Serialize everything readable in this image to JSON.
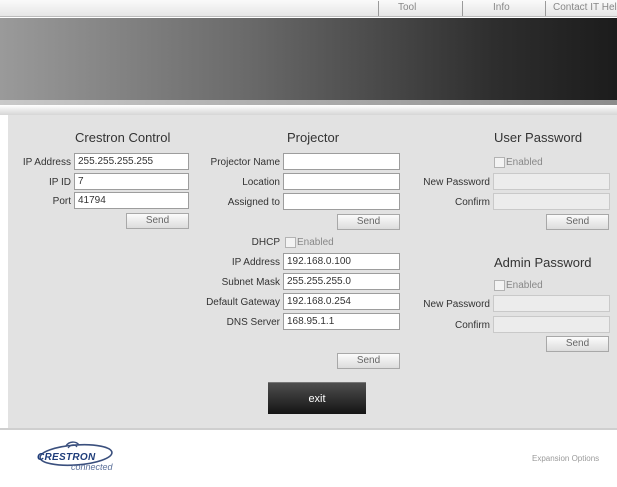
{
  "topnav": {
    "tool": "Tool",
    "info": "Info",
    "contact": "Contact IT Help"
  },
  "crestron": {
    "title": "Crestron Control",
    "ip_label": "IP Address",
    "ip_value": "255.255.255.255",
    "ipid_label": "IP ID",
    "ipid_value": "7",
    "port_label": "Port",
    "port_value": "41794",
    "send": "Send"
  },
  "projector": {
    "title": "Projector",
    "name_label": "Projector Name",
    "name_value": "",
    "location_label": "Location",
    "location_value": "",
    "assigned_label": "Assigned to",
    "assigned_value": "",
    "send1": "Send",
    "dhcp_label": "DHCP",
    "dhcp_enabled": "Enabled",
    "ip_label": "IP Address",
    "ip_value": "192.168.0.100",
    "subnet_label": "Subnet Mask",
    "subnet_value": "255.255.255.0",
    "gateway_label": "Default Gateway",
    "gateway_value": "192.168.0.254",
    "dns_label": "DNS Server",
    "dns_value": "168.95.1.1",
    "send2": "Send"
  },
  "user_password": {
    "title": "User Password",
    "enabled": "Enabled",
    "new_label": "New Password",
    "confirm_label": "Confirm",
    "send": "Send"
  },
  "admin_password": {
    "title": "Admin Password",
    "enabled": "Enabled",
    "new_label": "New Password",
    "confirm_label": "Confirm",
    "send": "Send"
  },
  "exit_label": "exit",
  "footer": {
    "logo_text": "CRESTRON",
    "logo_sub": "connected",
    "expansion": "Expansion Options"
  },
  "colors": {
    "panel": "#e2e2e2",
    "exit_button": "#1c1c1c",
    "logo": "#1f3d7a"
  },
  "icons": {
    "logo": "crestron-logo-icon",
    "checkbox": "checkbox-icon"
  }
}
